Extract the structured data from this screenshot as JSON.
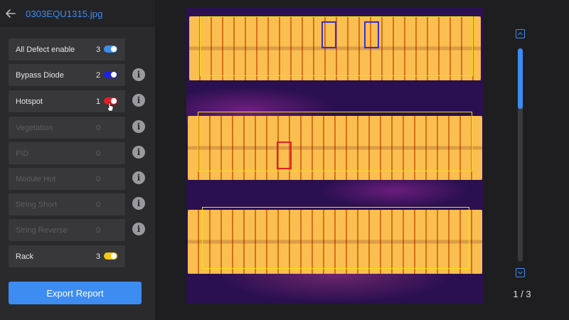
{
  "header": {
    "back_icon": "back-arrow-icon",
    "filename": "0303EQU1315.jpg"
  },
  "filters": [
    {
      "label": "All Defect enable",
      "count": "3",
      "enabled": true,
      "toggle_color": "#3d8cf2",
      "info": false
    },
    {
      "label": "Bypass Diode",
      "count": "2",
      "enabled": true,
      "toggle_color": "#1f22e0",
      "info": true
    },
    {
      "label": "Hotspot",
      "count": "1",
      "enabled": true,
      "toggle_color": "#e11e2a",
      "info": true
    },
    {
      "label": "Vegetation",
      "count": "0",
      "enabled": false,
      "info": true
    },
    {
      "label": "PID",
      "count": "0",
      "enabled": false,
      "info": true
    },
    {
      "label": "Module Hot",
      "count": "0",
      "enabled": false,
      "info": true
    },
    {
      "label": "String Short",
      "count": "0",
      "enabled": false,
      "info": true
    },
    {
      "label": "String Reverse",
      "count": "0",
      "enabled": false,
      "info": true
    },
    {
      "label": "Rack",
      "count": "3",
      "enabled": true,
      "toggle_color": "#f5c518",
      "info": false
    }
  ],
  "export_label": "Export Report",
  "pager": {
    "text": "1 / 3"
  },
  "colors": {
    "accent": "#3d8cf2",
    "rack_box": "#f5e20f",
    "bypass_box": "#3a2fd0",
    "hotspot_box": "#e11e2a"
  }
}
